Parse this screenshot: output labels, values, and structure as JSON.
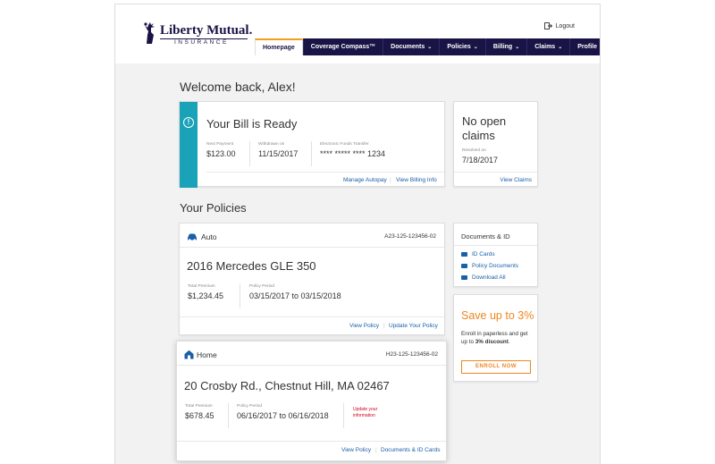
{
  "brand": {
    "name": "Liberty Mutual.",
    "sub": "INSURANCE",
    "navy": "#1a1446",
    "accent": "#f0a01e",
    "teal": "#1aa3b8",
    "orange": "#f0861e",
    "link": "#1a5fa8"
  },
  "header": {
    "logout_label": "Logout",
    "logout_icon": "logout-icon"
  },
  "nav": {
    "items": [
      {
        "label": "Homepage",
        "active": true
      },
      {
        "label": "Coverage Compass™"
      },
      {
        "label": "Documents",
        "caret": "⌄"
      },
      {
        "label": "Policies",
        "caret": "⌄"
      },
      {
        "label": "Billing",
        "caret": "⌄"
      },
      {
        "label": "Claims",
        "caret": "⌄"
      },
      {
        "label": "Profile",
        "caret": "⌄"
      }
    ]
  },
  "welcome": "Welcome back, Alex!",
  "bill": {
    "title": "Your Bill is Ready",
    "next_payment_label": "Next Payment",
    "next_payment_value": "$123.00",
    "withdrawn_label": "Withdrawn on",
    "withdrawn_value": "11/15/2017",
    "eft_label": "Electronic Funds Transfer",
    "eft_value": "**** ***** **** 1234",
    "manage_autopay": "Manage Autopay",
    "view_billing": "View Billing Info"
  },
  "claims": {
    "title": "No open claims",
    "resolved_label": "Resolved on",
    "resolved_value": "7/18/2017",
    "view_claims": "View Claims"
  },
  "policies_title": "Your Policies",
  "auto": {
    "type": "Auto",
    "number": "A23-125-123456-02",
    "name": "2016 Mercedes GLE 350",
    "premium_label": "Total Premium",
    "premium_value": "$1,234.45",
    "period_label": "Policy Period",
    "period_value": "03/15/2017 to 03/15/2018",
    "view_policy": "View Policy",
    "update_policy": "Update Your Policy"
  },
  "home": {
    "type": "Home",
    "number": "H23-125-123456-02",
    "name": "20 Crosby Rd., Chestnut Hill, MA 02467",
    "premium_label": "Total Premium",
    "premium_value": "$678.45",
    "period_label": "Policy Period",
    "period_value": "06/16/2017 to 06/16/2018",
    "update_note": "Update your information",
    "view_policy": "View Policy",
    "docs_cards": "Documents & ID Cards"
  },
  "docs": {
    "title": "Documents & ID",
    "items": [
      "ID Cards",
      "Policy Documents",
      "Download All"
    ]
  },
  "save": {
    "title": "Save up to 3%",
    "text_prefix": "Enroll in paperless and get up to ",
    "text_bold": "3% discount",
    "text_suffix": ".",
    "enroll": "ENROLL NOW"
  }
}
